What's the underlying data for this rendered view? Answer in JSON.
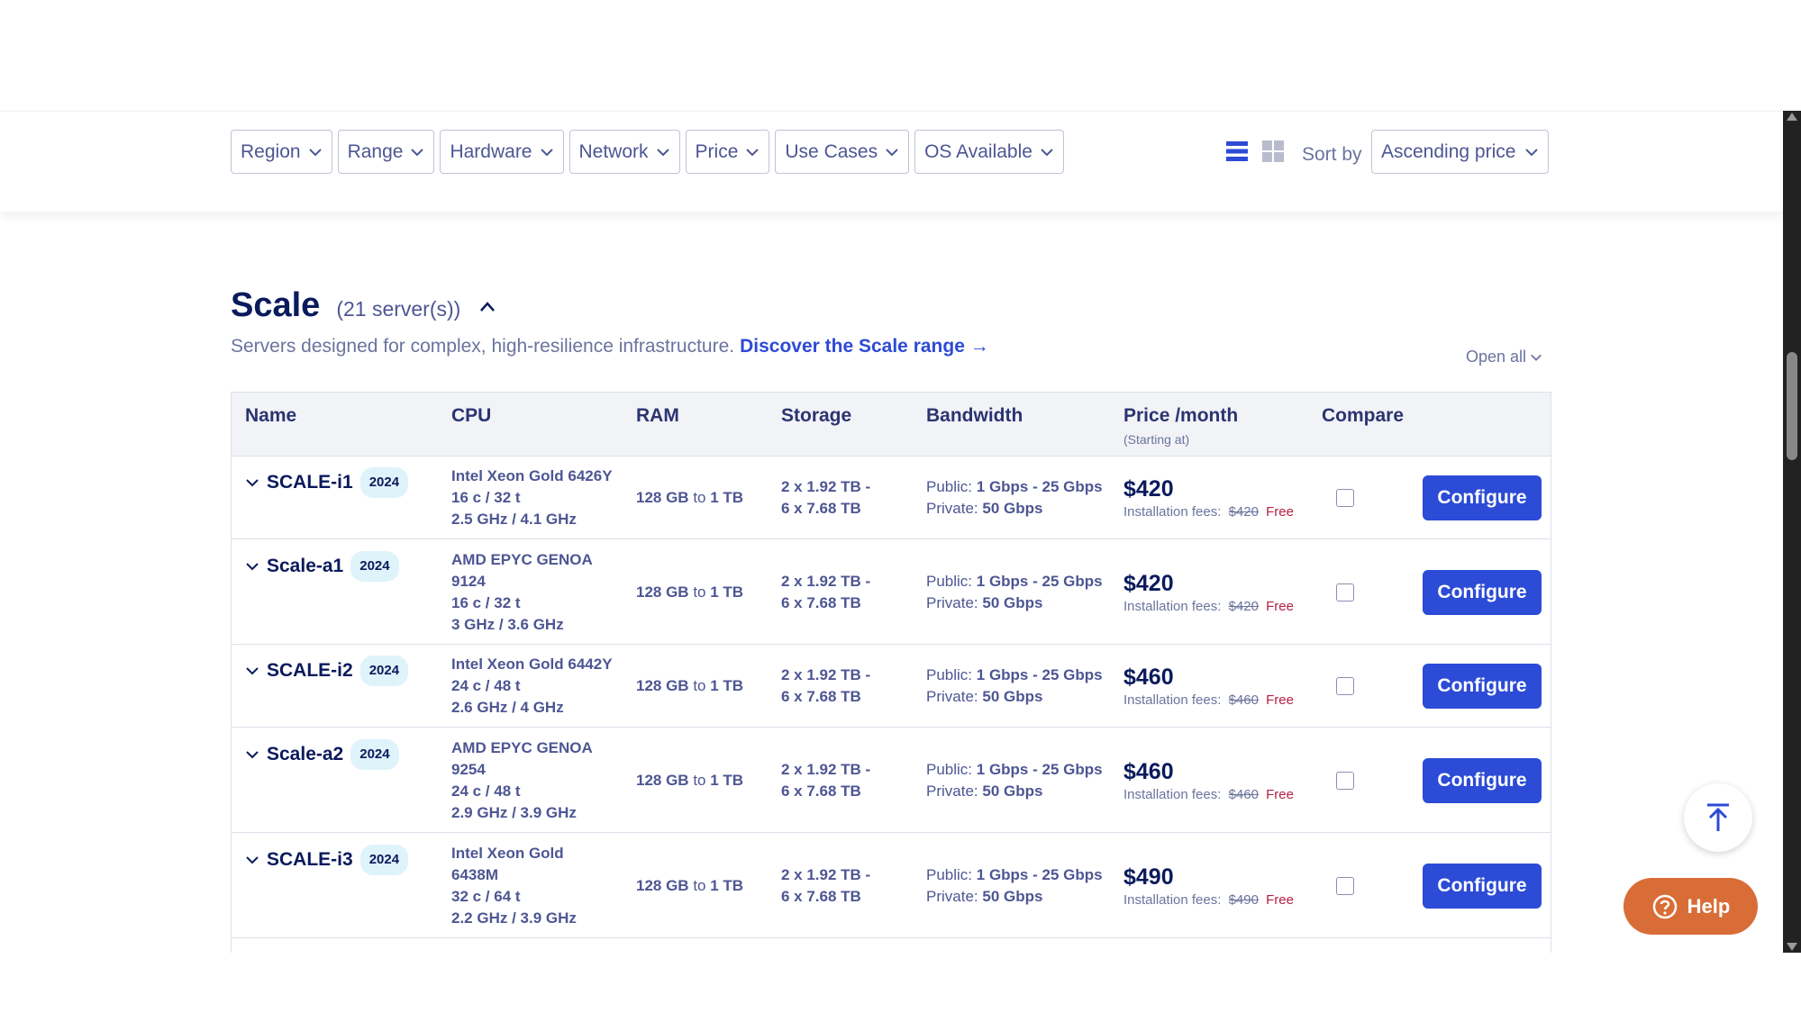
{
  "filters": [
    "Region",
    "Range",
    "Hardware",
    "Network",
    "Price",
    "Use Cases",
    "OS Available"
  ],
  "sort": {
    "label": "Sort by",
    "value": "Ascending price"
  },
  "section": {
    "title": "Scale",
    "count": "(21 server(s))",
    "description": "Servers designed for complex, high-resilience infrastructure.",
    "link": "Discover the Scale range →",
    "open_all": "Open all"
  },
  "table": {
    "headers": {
      "name": "Name",
      "cpu": "CPU",
      "ram": "RAM",
      "storage": "Storage",
      "bandwidth": "Bandwidth",
      "price": "Price /month",
      "price_sub": "(Starting at)",
      "compare": "Compare"
    },
    "rows": [
      {
        "name": "SCALE-i1",
        "badge": "2024",
        "cpu": [
          "Intel Xeon Gold 6426Y",
          "16 c / 32 t",
          "2.5 GHz / 4.1 GHz"
        ],
        "ram_min": "128 GB",
        "ram_to": "to",
        "ram_max": "1 TB",
        "storage_1": "2 x 1.92 TB -",
        "storage_2": "6 x 7.68 TB",
        "bw_public_label": "Public:",
        "bw_public": "1 Gbps - 25 Gbps",
        "bw_private_label": "Private:",
        "bw_private": "50 Gbps",
        "price": "$420",
        "fees_label": "Installation fees:",
        "fees_old": "$420",
        "fees_new": "Free",
        "button": "Configure"
      },
      {
        "name": "Scale-a1",
        "badge": "2024",
        "cpu": [
          "AMD EPYC GENOA",
          "9124",
          "16 c / 32 t",
          "3 GHz / 3.6 GHz"
        ],
        "ram_min": "128 GB",
        "ram_to": "to",
        "ram_max": "1 TB",
        "storage_1": "2 x 1.92 TB -",
        "storage_2": "6 x 7.68 TB",
        "bw_public_label": "Public:",
        "bw_public": "1 Gbps - 25 Gbps",
        "bw_private_label": "Private:",
        "bw_private": "50 Gbps",
        "price": "$420",
        "fees_label": "Installation fees:",
        "fees_old": "$420",
        "fees_new": "Free",
        "button": "Configure"
      },
      {
        "name": "SCALE-i2",
        "badge": "2024",
        "cpu": [
          "Intel Xeon Gold 6442Y",
          "24 c / 48 t",
          "2.6 GHz / 4 GHz"
        ],
        "ram_min": "128 GB",
        "ram_to": "to",
        "ram_max": "1 TB",
        "storage_1": "2 x 1.92 TB -",
        "storage_2": "6 x 7.68 TB",
        "bw_public_label": "Public:",
        "bw_public": "1 Gbps - 25 Gbps",
        "bw_private_label": "Private:",
        "bw_private": "50 Gbps",
        "price": "$460",
        "fees_label": "Installation fees:",
        "fees_old": "$460",
        "fees_new": "Free",
        "button": "Configure"
      },
      {
        "name": "Scale-a2",
        "badge": "2024",
        "cpu": [
          "AMD EPYC GENOA",
          "9254",
          "24 c / 48 t",
          "2.9 GHz / 3.9 GHz"
        ],
        "ram_min": "128 GB",
        "ram_to": "to",
        "ram_max": "1 TB",
        "storage_1": "2 x 1.92 TB -",
        "storage_2": "6 x 7.68 TB",
        "bw_public_label": "Public:",
        "bw_public": "1 Gbps - 25 Gbps",
        "bw_private_label": "Private:",
        "bw_private": "50 Gbps",
        "price": "$460",
        "fees_label": "Installation fees:",
        "fees_old": "$460",
        "fees_new": "Free",
        "button": "Configure"
      },
      {
        "name": "SCALE-i3",
        "badge": "2024",
        "cpu": [
          "Intel Xeon Gold",
          "6438M",
          "32 c / 64 t",
          "2.2 GHz / 3.9 GHz"
        ],
        "ram_min": "128 GB",
        "ram_to": "to",
        "ram_max": "1 TB",
        "storage_1": "2 x 1.92 TB -",
        "storage_2": "6 x 7.68 TB",
        "bw_public_label": "Public:",
        "bw_public": "1 Gbps - 25 Gbps",
        "bw_private_label": "Private:",
        "bw_private": "50 Gbps",
        "price": "$490",
        "fees_label": "Installation fees:",
        "fees_old": "$490",
        "fees_new": "Free",
        "button": "Configure"
      }
    ]
  },
  "help": {
    "label": "Help"
  },
  "colors": {
    "accent": "#2c4bd6",
    "title": "#0a1a5c",
    "help": "#d96d37",
    "free": "#b32045"
  }
}
